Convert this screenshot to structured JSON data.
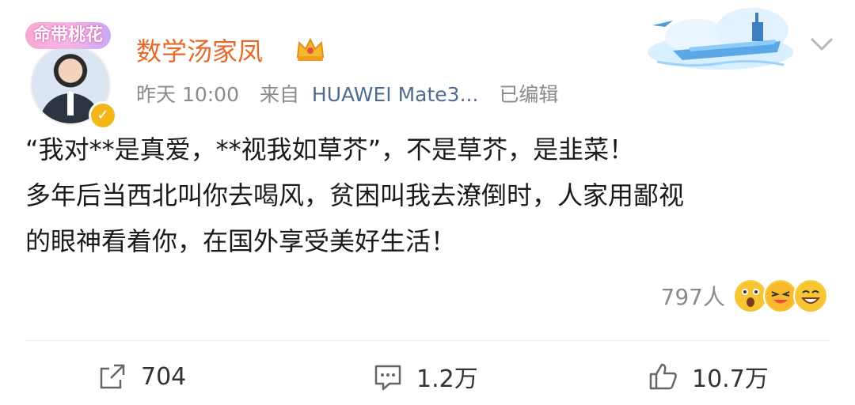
{
  "avatar": {
    "badge_text": "命带桃花",
    "verified_symbol": "✓"
  },
  "post": {
    "username": "数学汤家凤",
    "time": "昨天 10:00",
    "source_prefix": "来自",
    "device": "HUAWEI Mate3...",
    "edited": "已编辑",
    "lines": [
      "“我对**是真爱，**视我如草芥”，不是草芥，是韭菜！",
      "多年后当西北叫你去喝风，贫困叫我去潦倒时，人家用鄙视",
      "的眼神看着你，在国外享受美好生活！"
    ]
  },
  "reactions": {
    "count": "797人"
  },
  "actions": {
    "repost": "704",
    "comment": "1.2万",
    "like": "10.7万"
  },
  "colors": {
    "username": "#e8692a",
    "meta": "#8a8a8a",
    "verified": "#f4b71a",
    "badge": "#f5b7e8"
  },
  "icons": {
    "crown": "crown-icon",
    "banner": "aircraft-carrier-banner",
    "chevron": "chevron-down-icon",
    "repost": "repost-icon",
    "comment": "comment-icon",
    "like": "thumbs-up-icon"
  }
}
